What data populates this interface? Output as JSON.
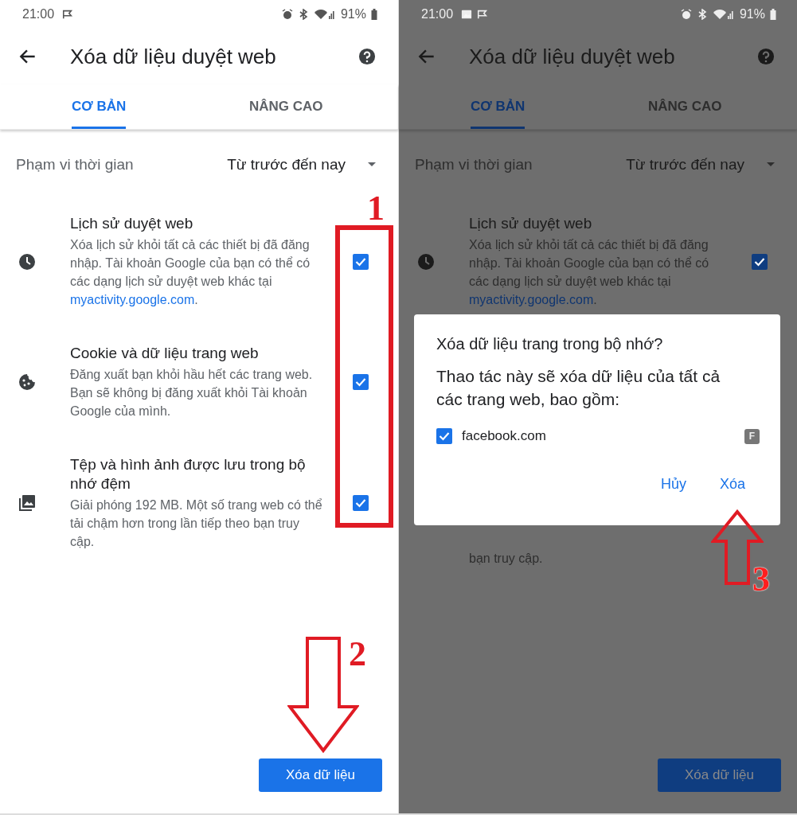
{
  "panels": [
    {
      "dimmed": false,
      "status_bar": {
        "time": "21:00",
        "notifications": [
          {
            "kind": "flag"
          }
        ],
        "battery": "91%"
      },
      "title": "Xóa dữ liệu duyệt web",
      "tabs": [
        {
          "label": "CƠ BẢN",
          "selected": true
        },
        {
          "label": "NÂNG CAO",
          "selected": false
        }
      ],
      "time_range": {
        "label": "Phạm vi thời gian",
        "value": "Từ trước đến nay"
      },
      "items": [
        {
          "kind": "clock",
          "title": "Lịch sử duyệt web",
          "description": "Xóa lịch sử khỏi tất cả các thiết bị đã đăng nhập. Tài khoản Google của bạn có thể có các dạng lịch sử duyệt web khác tại ",
          "link": "myactivity.google.com",
          "description_end": ".",
          "checked": true
        },
        {
          "kind": "cookie",
          "title": "Cookie và dữ liệu trang web",
          "description": "Đăng xuất bạn khỏi hầu hết các trang web. Bạn sẽ không bị đăng xuất khỏi Tài khoản Google của mình.",
          "checked": true
        },
        {
          "kind": "image",
          "title": "Tệp và hình ảnh được lưu trong bộ nhớ đệm",
          "description": "Giải phóng 192 MB. Một số trang web có thể tải chậm hơn trong lần tiếp theo bạn truy cập.",
          "checked": true
        }
      ],
      "button": "Xóa dữ liệu"
    },
    {
      "dimmed": true,
      "status_bar": {
        "time": "21:00",
        "notifications": [
          {
            "kind": "gallery"
          },
          {
            "kind": "flag"
          }
        ],
        "battery": "91%"
      },
      "title": "Xóa dữ liệu duyệt web",
      "tabs": [
        {
          "label": "CƠ BẢN",
          "selected": true
        },
        {
          "label": "NÂNG CAO",
          "selected": false
        }
      ],
      "time_range": {
        "label": "Phạm vi thời gian",
        "value": "Từ trước đến nay"
      },
      "items": [
        {
          "kind": "clock",
          "title": "Lịch sử duyệt web",
          "description": "Xóa lịch sử khỏi tất cả các thiết bị đã đăng nhập. Tài khoản Google của bạn có thể có các dạng lịch sử duyệt web khác tại ",
          "link": "myactivity.google.com",
          "description_end": ".",
          "checked": true
        }
      ],
      "visible_fragment": "bạn truy cập.",
      "dialog": {
        "title": "Xóa dữ liệu trang trong bộ nhớ?",
        "message": "Thao tác này sẽ xóa dữ liệu của tất cả các trang web, bao gồm:",
        "sites": [
          {
            "name": "facebook.com",
            "favicon_letter": "F",
            "checked": true
          }
        ],
        "buttons": [
          "Hủy",
          "Xóa"
        ]
      },
      "button": "Xóa dữ liệu"
    }
  ],
  "annotations": [
    {
      "kind": "frame",
      "label": "1"
    },
    {
      "kind": "down-arrow",
      "label": "2"
    },
    {
      "kind": "up-arrow",
      "label": "3"
    }
  ]
}
